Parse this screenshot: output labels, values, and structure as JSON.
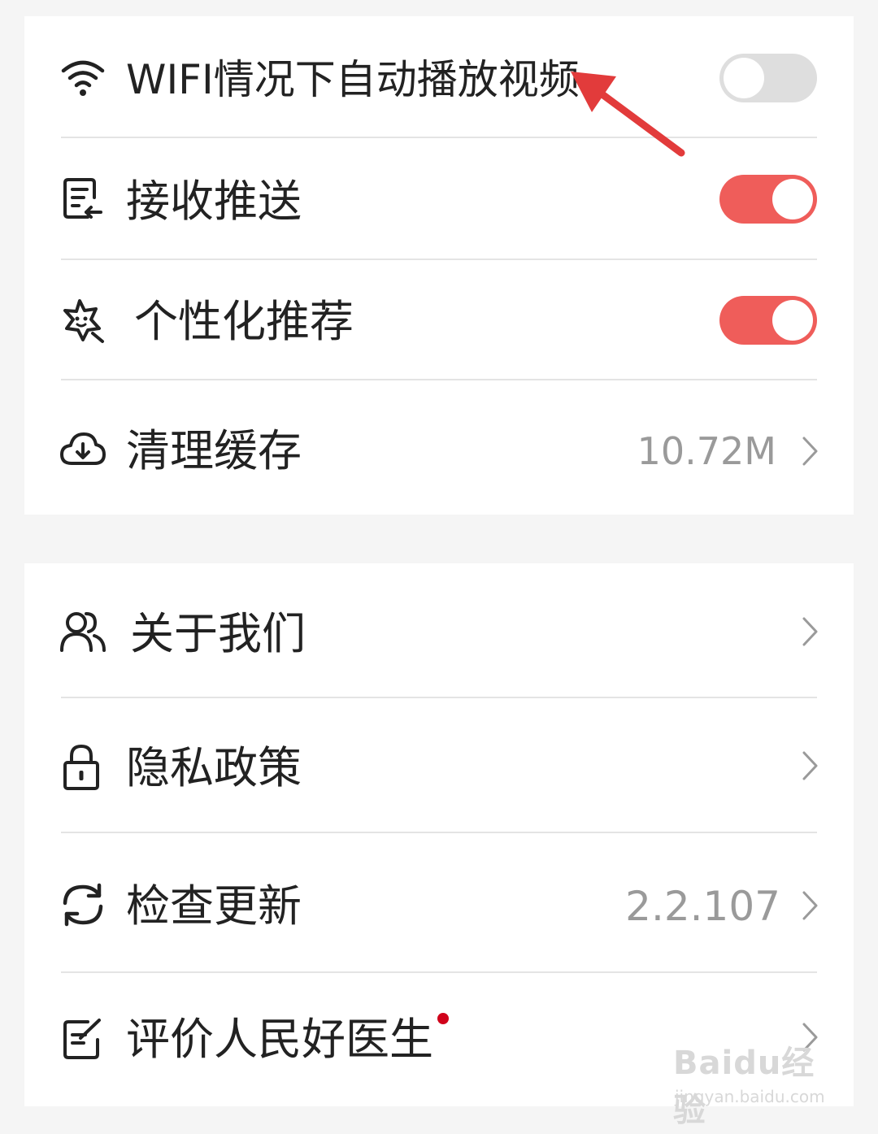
{
  "settings_card": {
    "items": [
      {
        "label": "WIFI情况下自动播放视频",
        "icon": "wifi-icon",
        "toggle": false
      },
      {
        "label": "接收推送",
        "icon": "push-receive-icon",
        "toggle": true
      },
      {
        "label": "个性化推荐",
        "icon": "star-face-icon",
        "toggle": true
      },
      {
        "label": "清理缓存",
        "icon": "cloud-download-icon",
        "value": "10.72M"
      }
    ]
  },
  "info_card": {
    "items": [
      {
        "label": "关于我们",
        "icon": "users-icon"
      },
      {
        "label": "隐私政策",
        "icon": "lock-icon"
      },
      {
        "label": "检查更新",
        "icon": "refresh-icon",
        "value": "2.2.107"
      },
      {
        "label": "评价人民好医生",
        "icon": "edit-note-icon"
      }
    ]
  },
  "watermark": {
    "logo": "Baidu经验",
    "url": "jingyan.baidu.com"
  },
  "colors": {
    "accent": "#ef5d5a",
    "toggle_off": "#dedede",
    "arrow": "#e23b3b",
    "badge": "#d0021b"
  }
}
